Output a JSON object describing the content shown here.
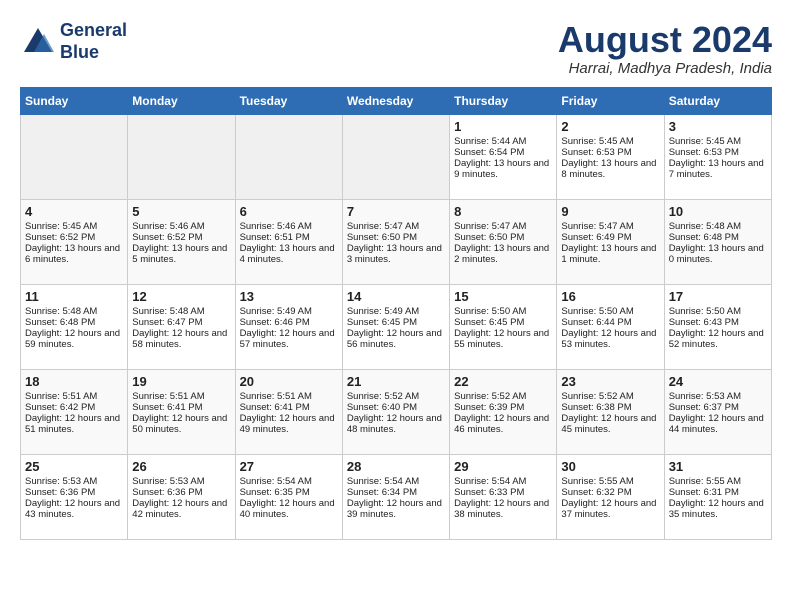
{
  "header": {
    "logo_line1": "General",
    "logo_line2": "Blue",
    "month_year": "August 2024",
    "location": "Harrai, Madhya Pradesh, India"
  },
  "days_of_week": [
    "Sunday",
    "Monday",
    "Tuesday",
    "Wednesday",
    "Thursday",
    "Friday",
    "Saturday"
  ],
  "weeks": [
    [
      {
        "day": "",
        "info": ""
      },
      {
        "day": "",
        "info": ""
      },
      {
        "day": "",
        "info": ""
      },
      {
        "day": "",
        "info": ""
      },
      {
        "day": "1",
        "info": "Sunrise: 5:44 AM\nSunset: 6:54 PM\nDaylight: 13 hours and 9 minutes."
      },
      {
        "day": "2",
        "info": "Sunrise: 5:45 AM\nSunset: 6:53 PM\nDaylight: 13 hours and 8 minutes."
      },
      {
        "day": "3",
        "info": "Sunrise: 5:45 AM\nSunset: 6:53 PM\nDaylight: 13 hours and 7 minutes."
      }
    ],
    [
      {
        "day": "4",
        "info": "Sunrise: 5:45 AM\nSunset: 6:52 PM\nDaylight: 13 hours and 6 minutes."
      },
      {
        "day": "5",
        "info": "Sunrise: 5:46 AM\nSunset: 6:52 PM\nDaylight: 13 hours and 5 minutes."
      },
      {
        "day": "6",
        "info": "Sunrise: 5:46 AM\nSunset: 6:51 PM\nDaylight: 13 hours and 4 minutes."
      },
      {
        "day": "7",
        "info": "Sunrise: 5:47 AM\nSunset: 6:50 PM\nDaylight: 13 hours and 3 minutes."
      },
      {
        "day": "8",
        "info": "Sunrise: 5:47 AM\nSunset: 6:50 PM\nDaylight: 13 hours and 2 minutes."
      },
      {
        "day": "9",
        "info": "Sunrise: 5:47 AM\nSunset: 6:49 PM\nDaylight: 13 hours and 1 minute."
      },
      {
        "day": "10",
        "info": "Sunrise: 5:48 AM\nSunset: 6:48 PM\nDaylight: 13 hours and 0 minutes."
      }
    ],
    [
      {
        "day": "11",
        "info": "Sunrise: 5:48 AM\nSunset: 6:48 PM\nDaylight: 12 hours and 59 minutes."
      },
      {
        "day": "12",
        "info": "Sunrise: 5:48 AM\nSunset: 6:47 PM\nDaylight: 12 hours and 58 minutes."
      },
      {
        "day": "13",
        "info": "Sunrise: 5:49 AM\nSunset: 6:46 PM\nDaylight: 12 hours and 57 minutes."
      },
      {
        "day": "14",
        "info": "Sunrise: 5:49 AM\nSunset: 6:45 PM\nDaylight: 12 hours and 56 minutes."
      },
      {
        "day": "15",
        "info": "Sunrise: 5:50 AM\nSunset: 6:45 PM\nDaylight: 12 hours and 55 minutes."
      },
      {
        "day": "16",
        "info": "Sunrise: 5:50 AM\nSunset: 6:44 PM\nDaylight: 12 hours and 53 minutes."
      },
      {
        "day": "17",
        "info": "Sunrise: 5:50 AM\nSunset: 6:43 PM\nDaylight: 12 hours and 52 minutes."
      }
    ],
    [
      {
        "day": "18",
        "info": "Sunrise: 5:51 AM\nSunset: 6:42 PM\nDaylight: 12 hours and 51 minutes."
      },
      {
        "day": "19",
        "info": "Sunrise: 5:51 AM\nSunset: 6:41 PM\nDaylight: 12 hours and 50 minutes."
      },
      {
        "day": "20",
        "info": "Sunrise: 5:51 AM\nSunset: 6:41 PM\nDaylight: 12 hours and 49 minutes."
      },
      {
        "day": "21",
        "info": "Sunrise: 5:52 AM\nSunset: 6:40 PM\nDaylight: 12 hours and 48 minutes."
      },
      {
        "day": "22",
        "info": "Sunrise: 5:52 AM\nSunset: 6:39 PM\nDaylight: 12 hours and 46 minutes."
      },
      {
        "day": "23",
        "info": "Sunrise: 5:52 AM\nSunset: 6:38 PM\nDaylight: 12 hours and 45 minutes."
      },
      {
        "day": "24",
        "info": "Sunrise: 5:53 AM\nSunset: 6:37 PM\nDaylight: 12 hours and 44 minutes."
      }
    ],
    [
      {
        "day": "25",
        "info": "Sunrise: 5:53 AM\nSunset: 6:36 PM\nDaylight: 12 hours and 43 minutes."
      },
      {
        "day": "26",
        "info": "Sunrise: 5:53 AM\nSunset: 6:36 PM\nDaylight: 12 hours and 42 minutes."
      },
      {
        "day": "27",
        "info": "Sunrise: 5:54 AM\nSunset: 6:35 PM\nDaylight: 12 hours and 40 minutes."
      },
      {
        "day": "28",
        "info": "Sunrise: 5:54 AM\nSunset: 6:34 PM\nDaylight: 12 hours and 39 minutes."
      },
      {
        "day": "29",
        "info": "Sunrise: 5:54 AM\nSunset: 6:33 PM\nDaylight: 12 hours and 38 minutes."
      },
      {
        "day": "30",
        "info": "Sunrise: 5:55 AM\nSunset: 6:32 PM\nDaylight: 12 hours and 37 minutes."
      },
      {
        "day": "31",
        "info": "Sunrise: 5:55 AM\nSunset: 6:31 PM\nDaylight: 12 hours and 35 minutes."
      }
    ]
  ]
}
